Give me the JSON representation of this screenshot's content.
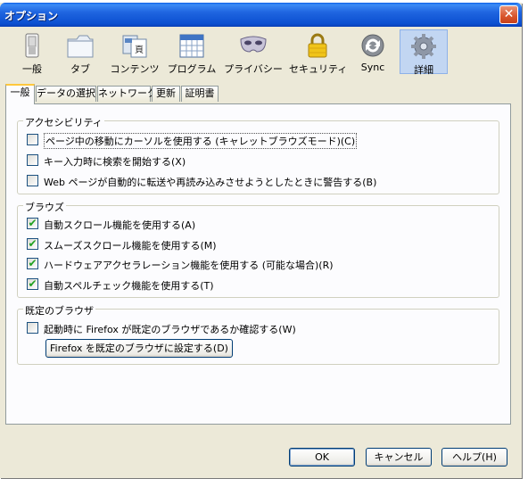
{
  "window": {
    "title": "オプション",
    "close_symbol": "✕"
  },
  "toolbar": [
    {
      "label": "一般",
      "icon": "switch-icon"
    },
    {
      "label": "タブ",
      "icon": "folder-tabs-icon"
    },
    {
      "label": "コンテンツ",
      "icon": "content-page-icon"
    },
    {
      "label": "プログラム",
      "icon": "calendar-grid-icon"
    },
    {
      "label": "プライバシー",
      "icon": "mask-icon"
    },
    {
      "label": "セキュリティ",
      "icon": "padlock-icon"
    },
    {
      "label": "Sync",
      "icon": "sync-arrows-icon"
    },
    {
      "label": "詳細",
      "icon": "gear-icon",
      "selected": true
    }
  ],
  "tabs": [
    {
      "label": "一般",
      "active": true
    },
    {
      "label": "データの選択"
    },
    {
      "label": "ネットワーク"
    },
    {
      "label": "更新"
    },
    {
      "label": "証明書"
    }
  ],
  "accessibility": {
    "title": "アクセシビリティ",
    "items": [
      {
        "label": "ページ中の移動にカーソルを使用する (キャレットブラウズモード)(C)",
        "checked": false
      },
      {
        "label": "キー入力時に検索を開始する(X)",
        "checked": false
      },
      {
        "label": "Web ページが自動的に転送や再読み込みさせようとしたときに警告する(B)",
        "checked": false
      }
    ]
  },
  "browsing": {
    "title": "ブラウズ",
    "items": [
      {
        "label": "自動スクロール機能を使用する(A)",
        "checked": true
      },
      {
        "label": "スムーズスクロール機能を使用する(M)",
        "checked": true
      },
      {
        "label": "ハードウェアアクセラレーション機能を使用する (可能な場合)(R)",
        "checked": true
      },
      {
        "label": "自動スペルチェック機能を使用する(T)",
        "checked": true
      }
    ]
  },
  "default_browser": {
    "title": "既定のブラウザ",
    "items": [
      {
        "label": "起動時に Firefox が既定のブラウザであるか確認する(W)",
        "checked": false
      }
    ],
    "button_label": "Firefox を既定のブラウザに設定する(D)"
  },
  "footer": {
    "ok": "OK",
    "cancel": "キャンセル",
    "help": "ヘルプ(H)"
  },
  "check_symbol": "✔"
}
